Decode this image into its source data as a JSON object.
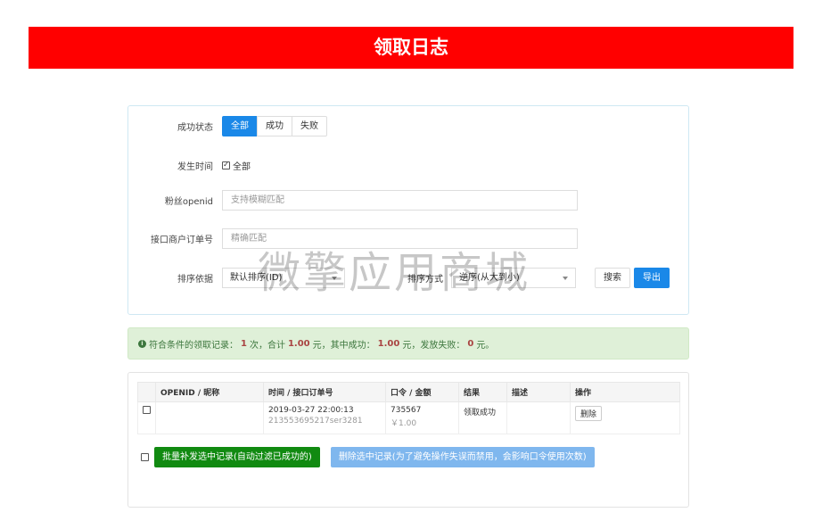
{
  "title": "领取日志",
  "filters": {
    "status_label": "成功状态",
    "status_options": [
      "全部",
      "成功",
      "失败"
    ],
    "status_selected": "全部",
    "time_label": "发生时间",
    "time_all_label": "全部",
    "openid_label": "粉丝openid",
    "openid_placeholder": "支持模糊匹配",
    "order_label": "接口商户订单号",
    "order_placeholder": "精确匹配",
    "sort_label": "排序依据",
    "sort_value": "默认排序(ID)",
    "sort_dir_label": "排序方式",
    "sort_dir_value": "逆序(从大到小)",
    "search_button": "搜索",
    "export_button": "导出"
  },
  "summary": {
    "text_prefix": "符合条件的领取记录：",
    "count": "1",
    "text_count_unit": "次，合计",
    "total": "1.00",
    "text_total_unit": "元，其中成功：",
    "success": "1.00",
    "text_success_unit": "元，发放失败：",
    "failed": "0",
    "text_suffix": "元。"
  },
  "table": {
    "columns": [
      "OPENID / 昵称",
      "时间 / 接口订单号",
      "口令 / 金额",
      "结果",
      "描述",
      "操作"
    ],
    "rows": [
      {
        "openid": "",
        "time": "2019-03-27 22:00:13",
        "order_no": "213553695217ser3281",
        "code": "735567",
        "amount": "￥1.00",
        "result": "领取成功",
        "desc": "",
        "action": "删除"
      }
    ]
  },
  "bulk": {
    "resend_button": "批量补发选中记录(自动过滤已成功的)",
    "delete_button": "删除选中记录(为了避免操作失误而禁用，会影响口令使用次数)"
  },
  "watermark": "微擎应用商城",
  "colors": {
    "banner": "#ff0000",
    "primary": "#1a88e8",
    "success_green": "#118a11",
    "alert_bg": "#dff0d8"
  }
}
